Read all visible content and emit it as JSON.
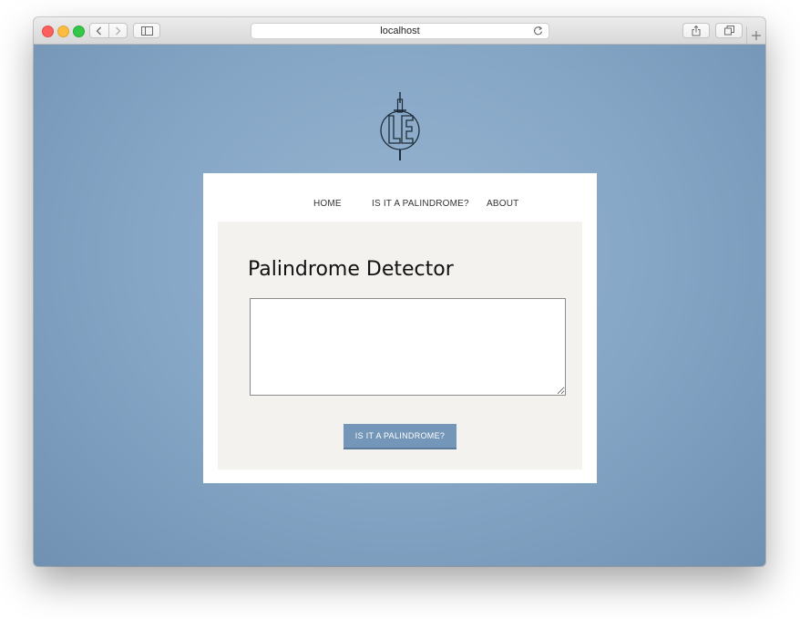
{
  "browser": {
    "address": "localhost"
  },
  "site": {
    "logo_text": "LE",
    "nav": [
      {
        "label": "HOME"
      },
      {
        "label": "IS IT A PALINDROME?"
      },
      {
        "label": "ABOUT"
      }
    ]
  },
  "main": {
    "title": "Palindrome Detector",
    "textarea_value": "",
    "submit_label": "IS IT A PALINDROME?"
  },
  "colors": {
    "background": "#86a6c6",
    "button": "#7496b8",
    "panel": "#f4f2ee"
  }
}
